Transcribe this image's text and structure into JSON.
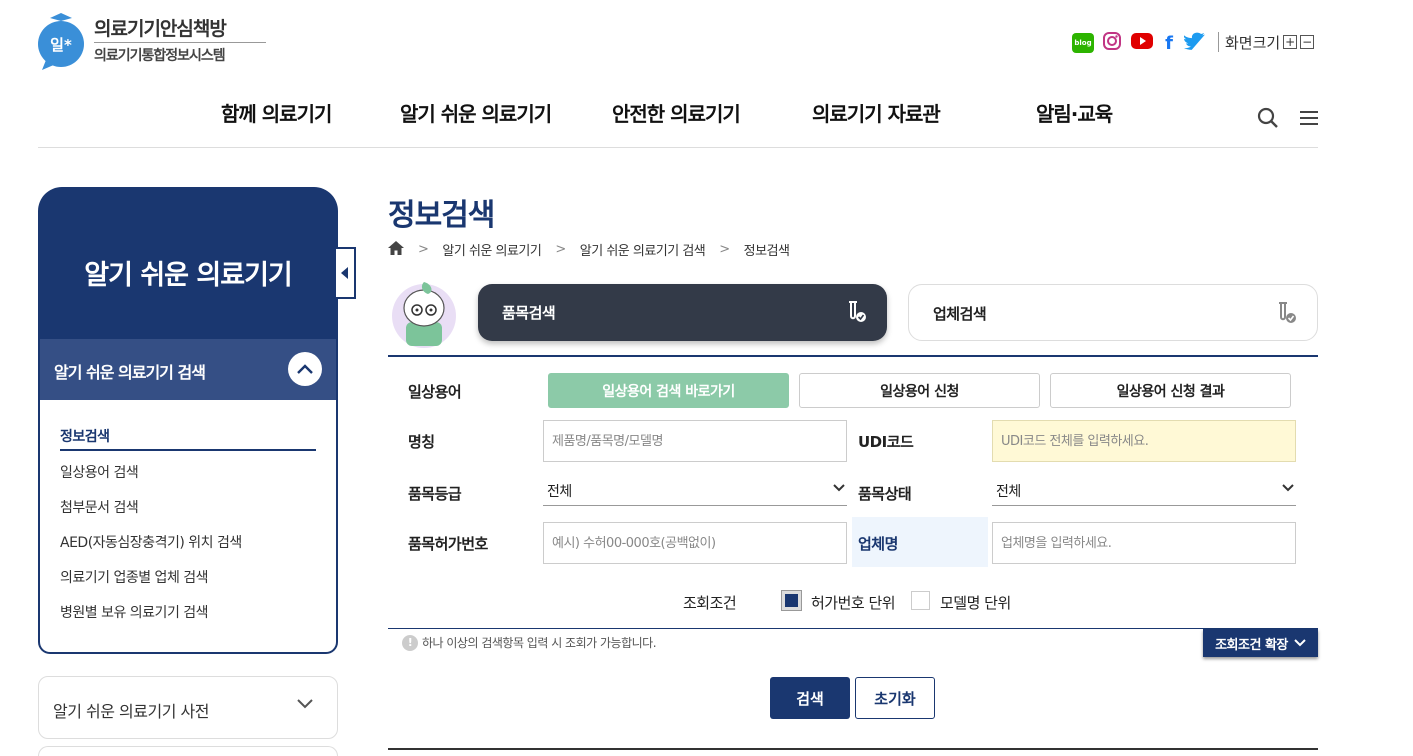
{
  "header": {
    "logo_title": "의료기기안심책방",
    "logo_subtitle": "의료기기통합정보시스템",
    "logo_mark_text": "일*",
    "sns": [
      {
        "name": "blog",
        "label": "blog",
        "color": "#2db400"
      },
      {
        "name": "instagram",
        "label": "",
        "color": "#c13584"
      },
      {
        "name": "youtube",
        "label": "",
        "color": "#e00000"
      },
      {
        "name": "facebook",
        "label": "f",
        "color": "#1877f2"
      },
      {
        "name": "twitter",
        "label": "",
        "color": "#1d9bf0"
      }
    ],
    "fontsize_label": "화면크기",
    "fontsize_plus": "+",
    "fontsize_minus": "−",
    "gnb": [
      "함께 의료기기",
      "알기 쉬운 의료기기",
      "안전한 의료기기",
      "의료기기 자료관",
      "알림·교육"
    ]
  },
  "sidebar": {
    "title": "알기 쉬운 의료기기",
    "section_label": "알기 쉬운 의료기기 검색",
    "items": [
      "정보검색",
      "일상용어 검색",
      "첨부문서 검색",
      "AED(자동심장충격기) 위치 검색",
      "의료기기 업종별 업체 검색",
      "병원별 보유 의료기기 검색"
    ],
    "active_index": 0,
    "dict_label": "알기 쉬운 의료기기 사전"
  },
  "main": {
    "page_title": "정보검색",
    "breadcrumb": [
      "알기 쉬운 의료기기",
      "알기 쉬운 의료기기 검색",
      "정보검색"
    ],
    "tabs": {
      "product": "품목검색",
      "company": "업체검색"
    },
    "form": {
      "daily_term_label": "일상용어",
      "daily_buttons": [
        "일상용어 검색 바로가기",
        "일상용어 신청",
        "일상용어 신청 결과"
      ],
      "name_label": "명칭",
      "name_placeholder": "제품명/품목명/모델명",
      "udi_label": "UDI코드",
      "udi_placeholder": "UDI코드 전체를 입력하세요.",
      "grade_label": "품목등급",
      "grade_value": "전체",
      "status_label": "품목상태",
      "status_value": "전체",
      "permit_label": "품목허가번호",
      "permit_placeholder": "예시) 수허00-000호(공백없이)",
      "company_label": "업체명",
      "company_placeholder": "업체명을 입력하세요.",
      "condition_label": "조회조건",
      "condition_options": [
        {
          "label": "허가번호 단위",
          "checked": true
        },
        {
          "label": "모델명 단위",
          "checked": false
        }
      ]
    },
    "notice": "하나 이상의 검색항목 입력 시 조회가 가능합니다.",
    "notice_mark": "!",
    "expand_label": "조회조건 확장",
    "search_label": "검색",
    "reset_label": "초기화"
  },
  "colors": {
    "primary": "#1a3770",
    "green": "#8ccaa8",
    "dark_tab": "#333a48",
    "udi_bg": "#fff9d6"
  }
}
